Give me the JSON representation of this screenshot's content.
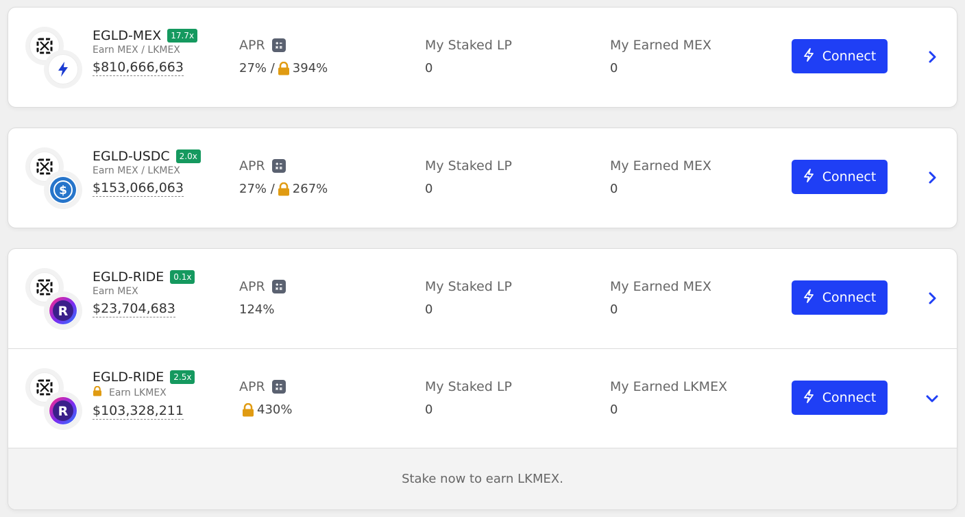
{
  "colors": {
    "accent": "#1f3ff5",
    "badge": "#15995f",
    "lock": "#e09b12"
  },
  "connect_label": "Connect",
  "farms": [
    {
      "pair": "EGLD-MEX",
      "multiplier": "17.7x",
      "earn": "Earn MEX / LKMEX",
      "tvl": "$810,666,663",
      "apr_label": "APR",
      "apr_base": "27% /",
      "apr_locked": "394%",
      "staked_label": "My Staked LP",
      "staked_value": "0",
      "earned_label": "My Earned MEX",
      "earned_value": "0",
      "token2_icon": "lightning-token-icon",
      "expanded": false
    },
    {
      "pair": "EGLD-USDC",
      "multiplier": "2.0x",
      "earn": "Earn MEX / LKMEX",
      "tvl": "$153,066,063",
      "apr_label": "APR",
      "apr_base": "27% /",
      "apr_locked": "267%",
      "staked_label": "My Staked LP",
      "staked_value": "0",
      "earned_label": "My Earned MEX",
      "earned_value": "0",
      "token2_icon": "usdc-token-icon",
      "expanded": false
    },
    {
      "pair": "EGLD-RIDE",
      "multiplier": "0.1x",
      "earn": "Earn MEX",
      "tvl": "$23,704,683",
      "apr_label": "APR",
      "apr_base": "124%",
      "apr_locked": "",
      "staked_label": "My Staked LP",
      "staked_value": "0",
      "earned_label": "My Earned MEX",
      "earned_value": "0",
      "token2_icon": "ride-token-icon",
      "expanded": false
    },
    {
      "pair": "EGLD-RIDE",
      "multiplier": "2.5x",
      "earn": "Earn LKMEX",
      "tvl": "$103,328,211",
      "apr_label": "APR",
      "apr_base": "",
      "apr_locked": "430%",
      "staked_label": "My Staked LP",
      "staked_value": "0",
      "earned_label": "My Earned LKMEX",
      "earned_value": "0",
      "token2_icon": "ride-token-icon",
      "expanded": true
    }
  ],
  "expanded_message": "Stake now to earn LKMEX."
}
